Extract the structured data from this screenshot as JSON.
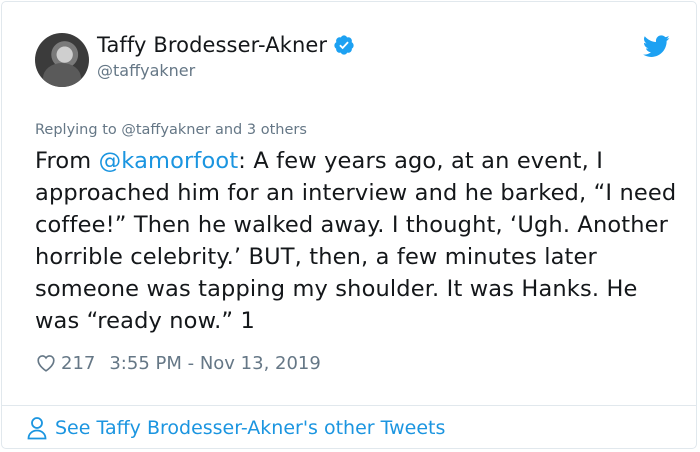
{
  "user": {
    "name": "Taffy Brodesser-Akner",
    "handle": "@taffyakner"
  },
  "replying": {
    "prefix": "Replying to ",
    "handle": "@taffyakner",
    "suffix": " and 3 others"
  },
  "tweet": {
    "prefix": "From ",
    "mention": "@kamorfoot",
    "body": ": A few years ago, at an event, I approached him for an interview and he barked, “I need coffee!” Then he walked away. I thought, ‘Ugh. Another horrible celebrity.’ BUT, then, a few minutes later someone was tapping my shoulder. It was Hanks. He was “ready now.” 1"
  },
  "meta": {
    "likes": "217",
    "timestamp": "3:55 PM - Nov 13, 2019"
  },
  "footer": {
    "link_label": "See Taffy Brodesser-Akner's other Tweets"
  },
  "colors": {
    "accent": "#1b95e0",
    "muted": "#657786",
    "verified": "#1da1f2"
  },
  "icons": {
    "verified": "verified-badge-icon",
    "bird": "twitter-bird-icon",
    "heart": "heart-icon",
    "person": "person-icon"
  }
}
